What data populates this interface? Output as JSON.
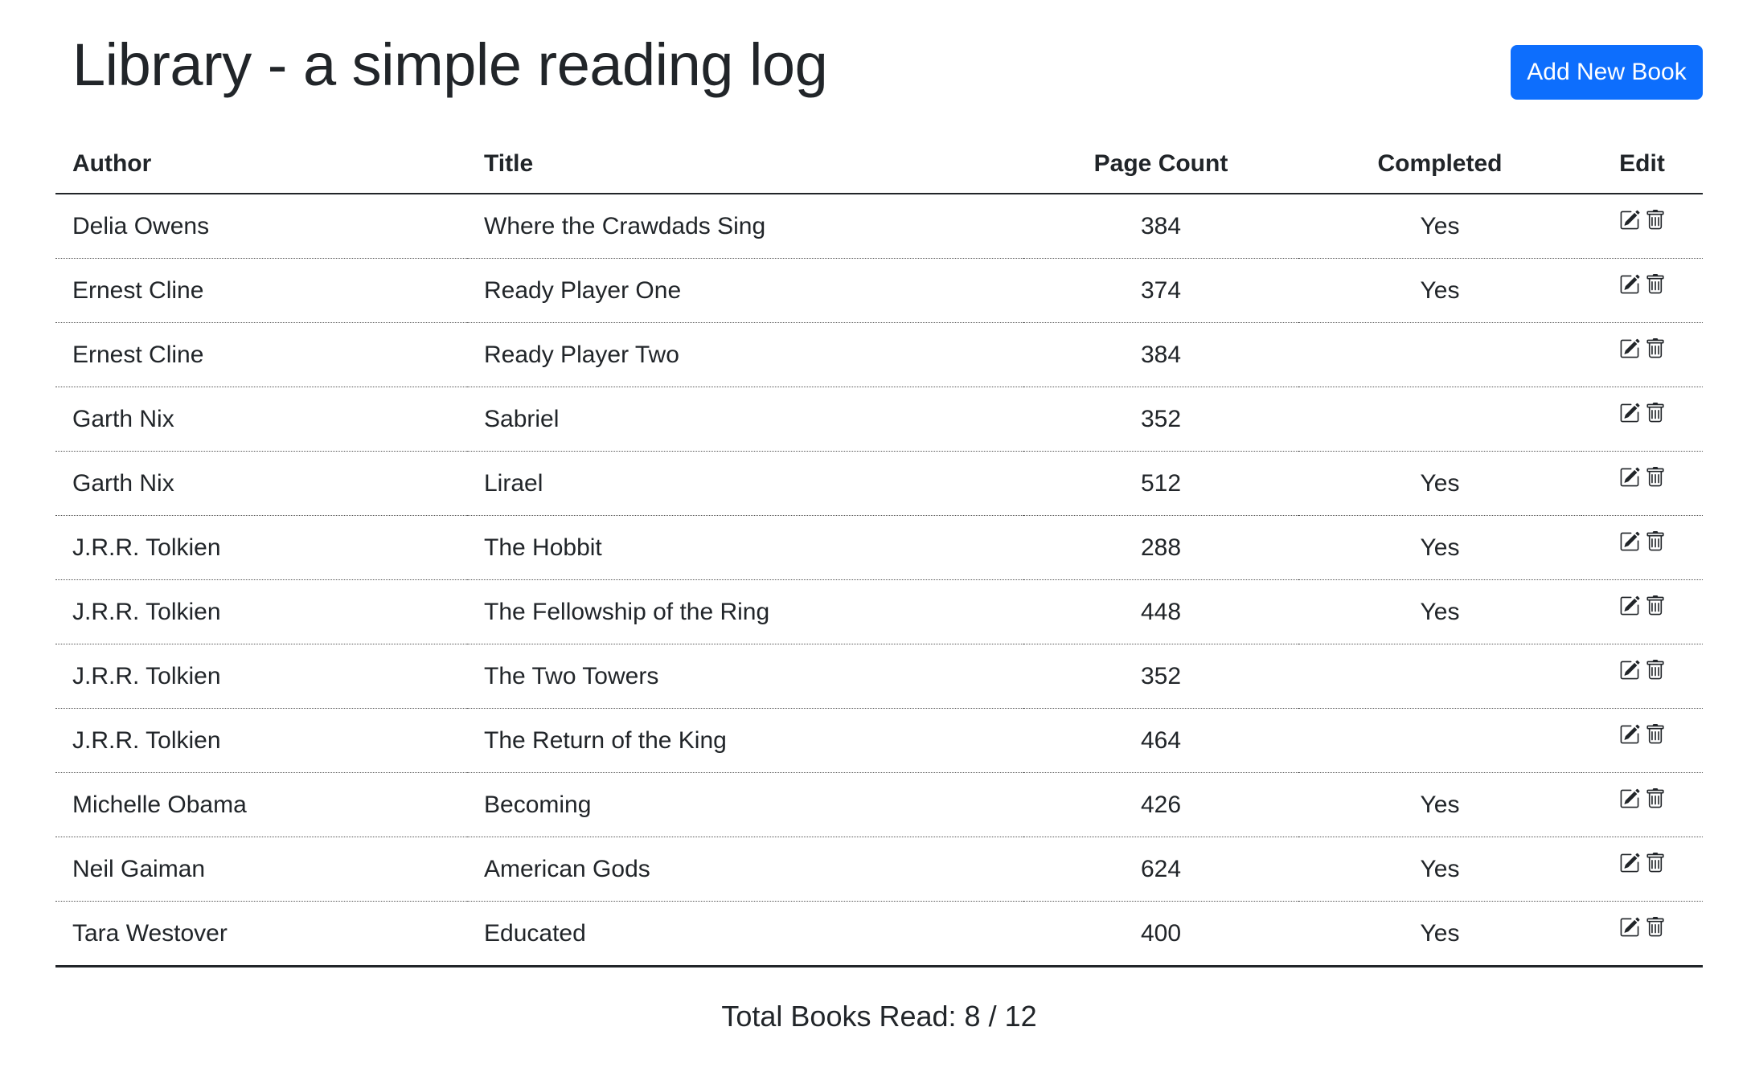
{
  "header": {
    "title": "Library - a simple reading log",
    "add_button_label": "Add New Book"
  },
  "table": {
    "columns": {
      "author": "Author",
      "title": "Title",
      "page_count": "Page Count",
      "completed": "Completed",
      "edit": "Edit"
    },
    "rows": [
      {
        "author": "Delia Owens",
        "title": "Where the Crawdads Sing",
        "pages": "384",
        "completed": "Yes"
      },
      {
        "author": "Ernest Cline",
        "title": "Ready Player One",
        "pages": "374",
        "completed": "Yes"
      },
      {
        "author": "Ernest Cline",
        "title": "Ready Player Two",
        "pages": "384",
        "completed": ""
      },
      {
        "author": "Garth Nix",
        "title": "Sabriel",
        "pages": "352",
        "completed": ""
      },
      {
        "author": "Garth Nix",
        "title": "Lirael",
        "pages": "512",
        "completed": "Yes"
      },
      {
        "author": "J.R.R. Tolkien",
        "title": "The Hobbit",
        "pages": "288",
        "completed": "Yes"
      },
      {
        "author": "J.R.R. Tolkien",
        "title": "The Fellowship of the Ring",
        "pages": "448",
        "completed": "Yes"
      },
      {
        "author": "J.R.R. Tolkien",
        "title": "The Two Towers",
        "pages": "352",
        "completed": ""
      },
      {
        "author": "J.R.R. Tolkien",
        "title": "The Return of the King",
        "pages": "464",
        "completed": ""
      },
      {
        "author": "Michelle Obama",
        "title": "Becoming",
        "pages": "426",
        "completed": "Yes"
      },
      {
        "author": "Neil Gaiman",
        "title": "American Gods",
        "pages": "624",
        "completed": "Yes"
      },
      {
        "author": "Tara Westover",
        "title": "Educated",
        "pages": "400",
        "completed": "Yes"
      }
    ],
    "row_icons": [
      "edit-icon",
      "trash-icon"
    ]
  },
  "footer": {
    "total_label": "Total Books Read: 8 / 12"
  },
  "colors": {
    "accent": "#0d6efd",
    "text": "#212529"
  }
}
